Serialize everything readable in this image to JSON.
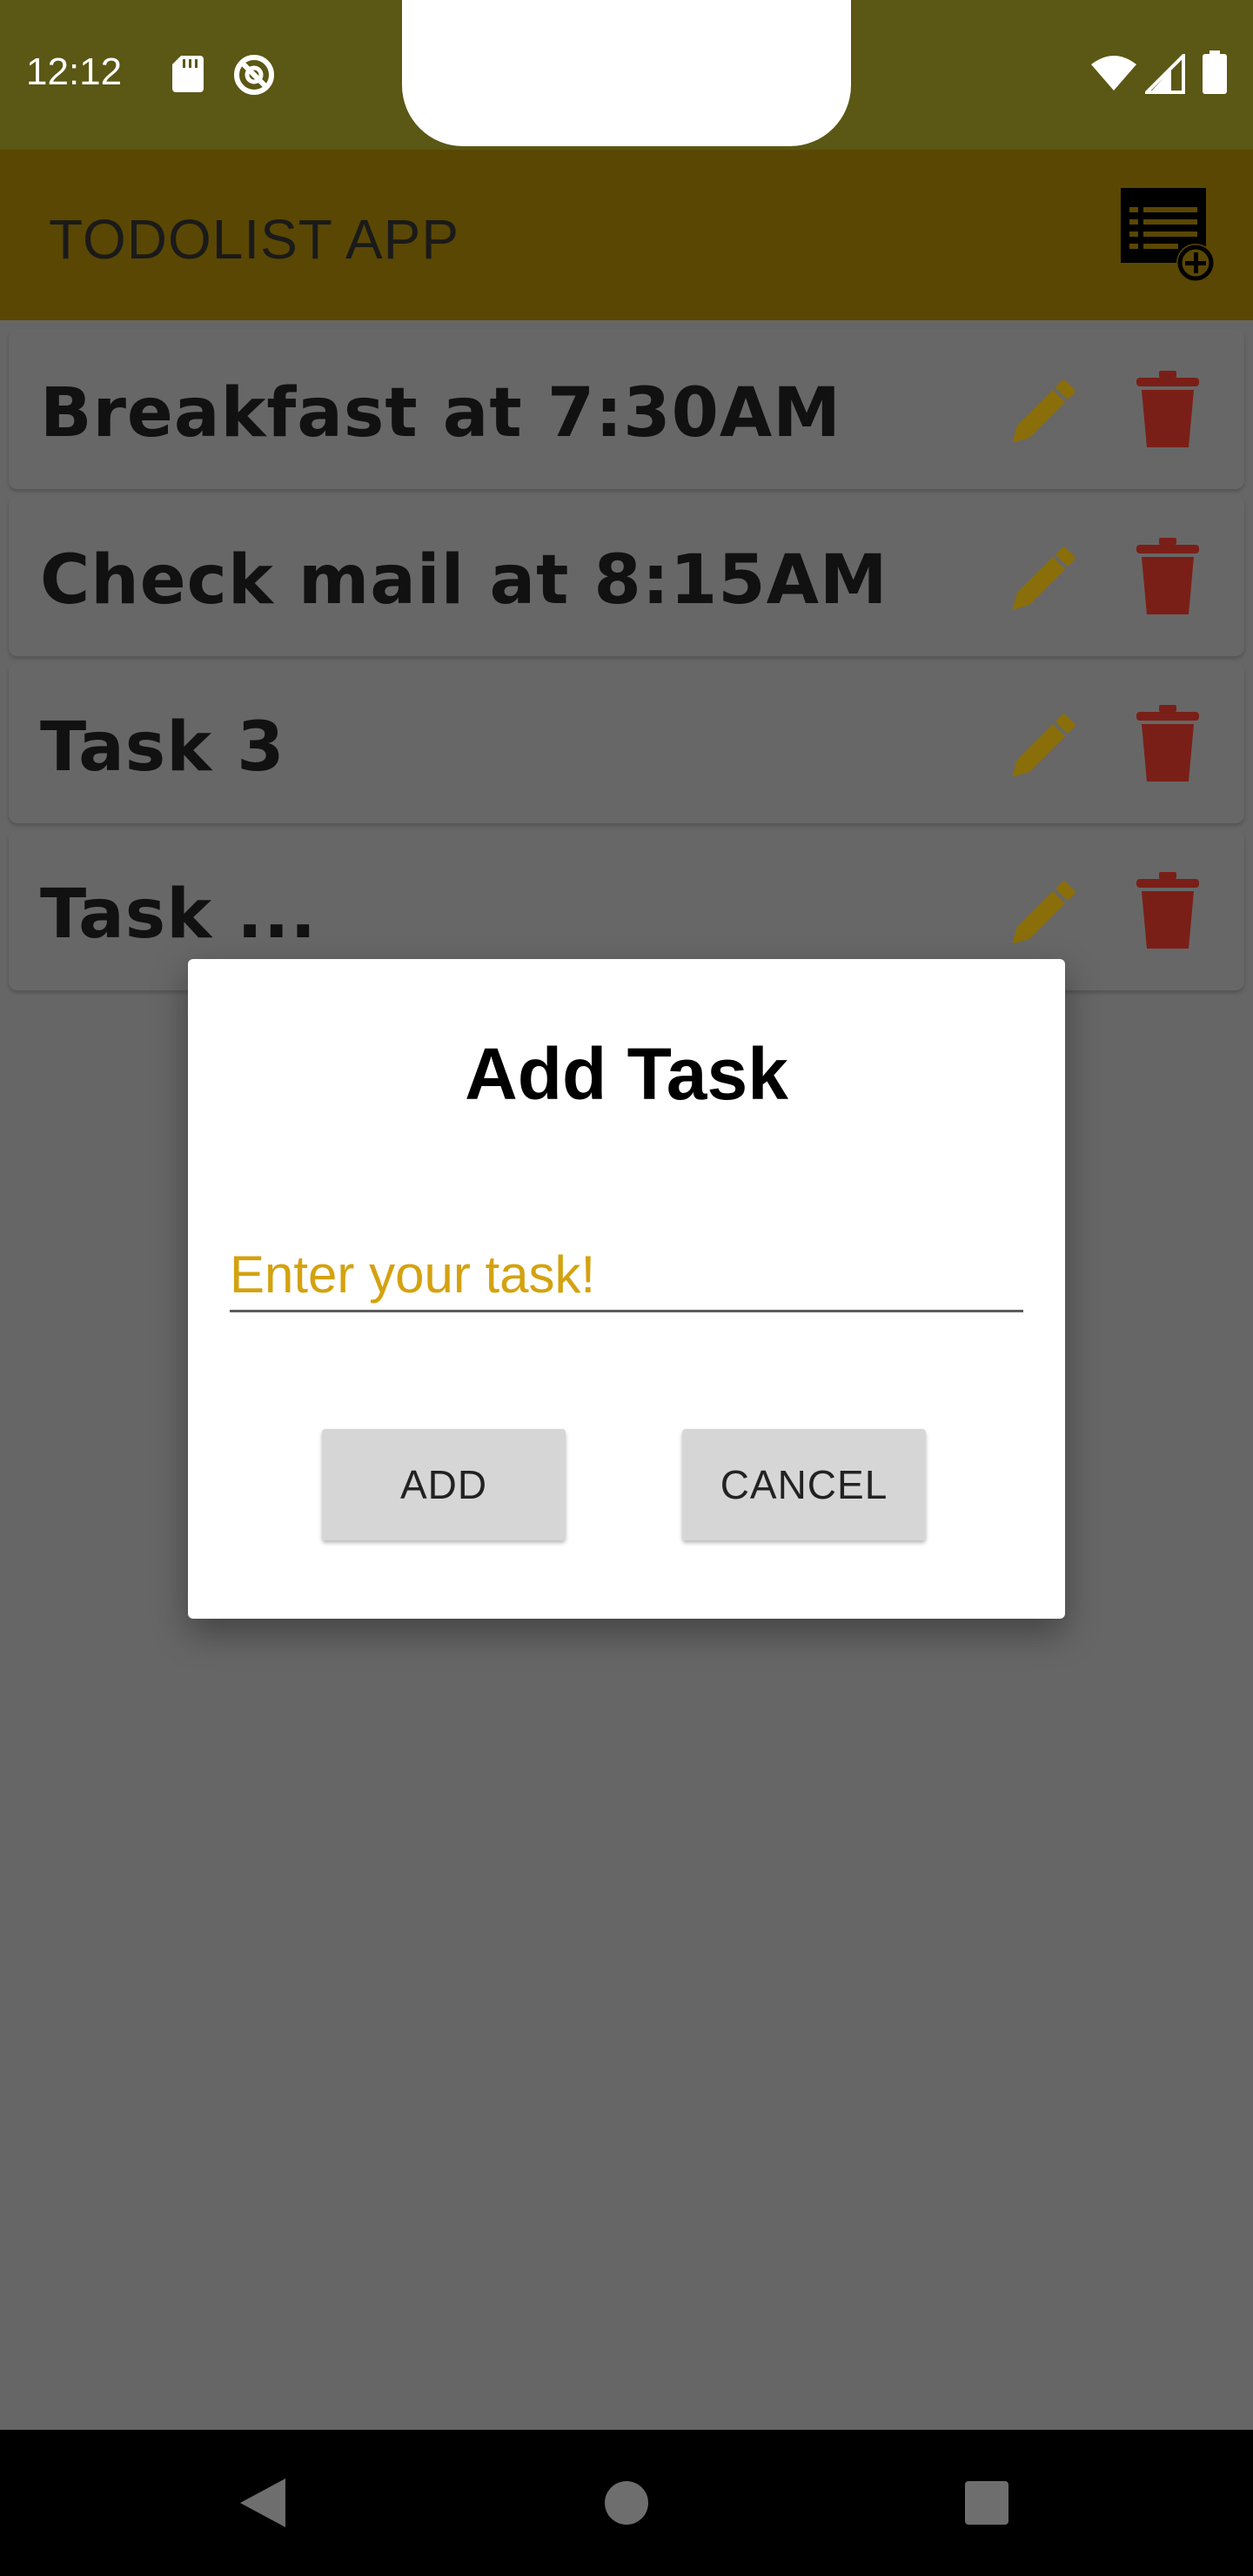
{
  "status_bar": {
    "time": "12:12",
    "icons": [
      "sd-card-icon",
      "no-sync-icon",
      "wifi-icon",
      "signal-icon",
      "battery-icon"
    ]
  },
  "app_bar": {
    "title": "TODOLIST APP",
    "action_icon": "add-list-icon"
  },
  "tasks": [
    {
      "text": "Breakfast at 7:30AM"
    },
    {
      "text": "Check mail at 8:15AM"
    },
    {
      "text": "Task 3"
    },
    {
      "text": "Task ..."
    }
  ],
  "dialog": {
    "title": "Add Task",
    "input_value": "",
    "input_placeholder": "Enter your task!",
    "add_label": "ADD",
    "cancel_label": "CANCEL"
  },
  "colors": {
    "status_bar": "#5b5714",
    "app_bar": "#5a4703",
    "edit_icon": "#8a6e0a",
    "delete_icon": "#7a1f17",
    "placeholder": "#d4a20f",
    "scrim": "#666666"
  },
  "nav_bar": {
    "icons": [
      "back-icon",
      "home-icon",
      "recents-icon"
    ]
  }
}
